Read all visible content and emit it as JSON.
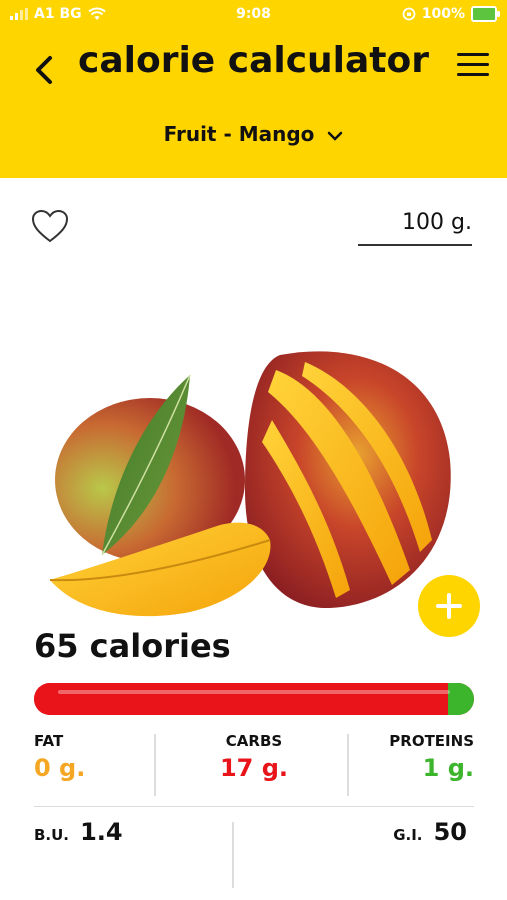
{
  "status_bar": {
    "carrier": "A1 BG",
    "time": "9:08",
    "battery": "100%",
    "battery_color": "#5dc440"
  },
  "header": {
    "title": "calorie calculator",
    "subtitle": "Fruit - Mango",
    "background": "#FFD500",
    "back_icon": "chevron-left-icon",
    "menu_icon": "hamburger-menu-icon",
    "dropdown_icon": "chevron-down-icon"
  },
  "favorite": {
    "icon": "heart-outline-icon"
  },
  "weight": {
    "value": "100 g."
  },
  "food_image": {
    "subject": "mango"
  },
  "add_button": {
    "icon": "plus-icon",
    "color": "#FFD500"
  },
  "calories": {
    "text": "65 calories"
  },
  "macro_bar": {
    "fat_fraction": 0,
    "carbs_fraction": 0.94,
    "proteins_fraction": 0.06,
    "carbs_color": "#e8141a",
    "proteins_color": "#3cb52c"
  },
  "macros": {
    "fat": {
      "label": "FAT",
      "value": "0 g.",
      "color": "#f5a623"
    },
    "carbs": {
      "label": "CARBS",
      "value": "17 g.",
      "color": "#e8141a"
    },
    "proteins": {
      "label": "PROTEINS",
      "value": "1 g.",
      "color": "#3cb52c"
    }
  },
  "indices": {
    "bu": {
      "label": "B.U.",
      "value": "1.4"
    },
    "gi": {
      "label": "G.I.",
      "value": "50"
    }
  }
}
